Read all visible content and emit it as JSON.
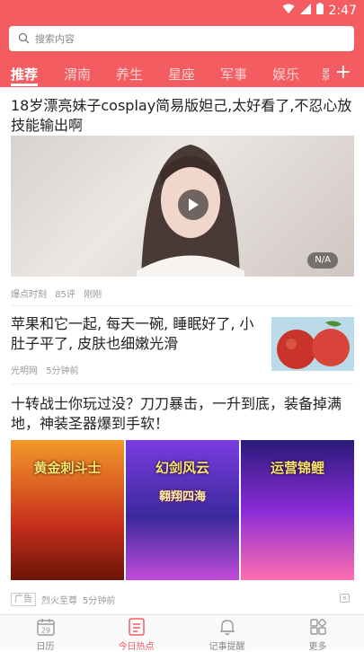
{
  "status_bar": {
    "time": "2:47"
  },
  "search": {
    "placeholder": "搜索内容"
  },
  "tabs": [
    {
      "label": "推荐",
      "active": true
    },
    {
      "label": "渭南"
    },
    {
      "label": "养生"
    },
    {
      "label": "星座"
    },
    {
      "label": "军事"
    },
    {
      "label": "娱乐"
    },
    {
      "label": "影"
    }
  ],
  "articles": [
    {
      "title": "18岁漂亮妹子cosplay简易版妲己,太好看了,不忍心放技能输出啊",
      "duration": "N/A",
      "source": "爆点时刻",
      "comments": "85评",
      "time": "刚刚"
    },
    {
      "title": "苹果和它一起, 每天一碗, 睡眠好了, 小肚子平了, 皮肤也细嫩光滑",
      "source": "光明网",
      "time": "5分钟前"
    },
    {
      "title": "十转战士你玩过没？刀刀暴击，一升到底，装备掉满地，神装圣器爆到手软！",
      "ad_badge": "广告",
      "source": "烈火至尊",
      "time": "5分钟前",
      "ad_images": [
        {
          "line1": "黄金刺斗士",
          "colors": [
            "#c8301c",
            "#f39a2a"
          ]
        },
        {
          "line1": "幻剑风云",
          "line2": "翱翔四海",
          "colors": [
            "#3a2a9c",
            "#c24bd8"
          ]
        },
        {
          "line1": "运营锦鲤",
          "colors": [
            "#5a22b8",
            "#ff6fb0"
          ]
        }
      ]
    }
  ],
  "bottom_nav": [
    {
      "label": "日历",
      "day": "29"
    },
    {
      "label": "今日热点",
      "active": true
    },
    {
      "label": "记事提醒"
    },
    {
      "label": "更多"
    }
  ],
  "colors": {
    "accent": "#f35d61",
    "inactive": "#888888"
  }
}
